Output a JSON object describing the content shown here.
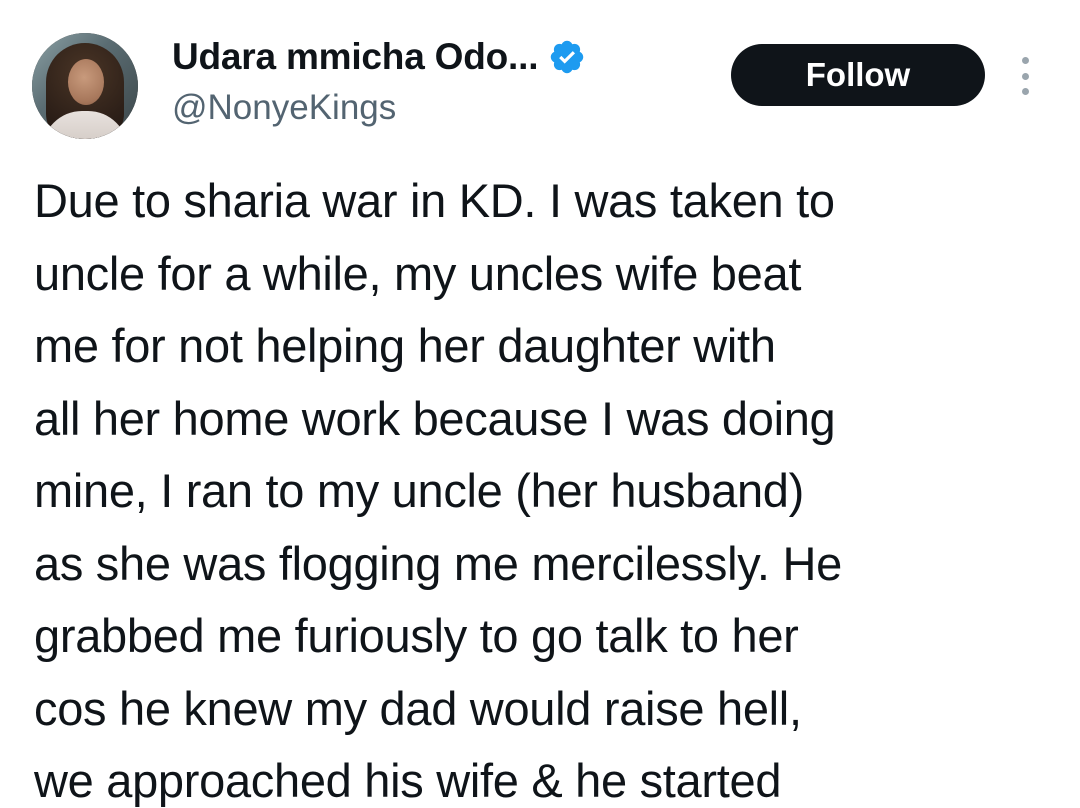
{
  "author": {
    "display_name": "Udara mmicha Odo...",
    "handle": "@NonyeKings",
    "verified": true,
    "verified_color": "#1d9bf0"
  },
  "actions": {
    "follow_label": "Follow",
    "more_icon": "more-vertical-icon"
  },
  "tweet": {
    "lines": [
      "Due to sharia war in KD. I was taken to",
      "uncle for a while, my uncles wife beat",
      "me for not helping her daughter with",
      "all her home work because I was doing",
      "mine, I ran to my uncle (her husband)",
      "as she was flogging me mercilessly. He",
      "grabbed me furiously to go talk to her",
      "cos he knew my dad would raise hell,",
      "we approached his wife & he started"
    ]
  },
  "colors": {
    "text": "#0f1419",
    "secondary": "#536471",
    "button_bg": "#0f1419",
    "button_text": "#ffffff"
  }
}
